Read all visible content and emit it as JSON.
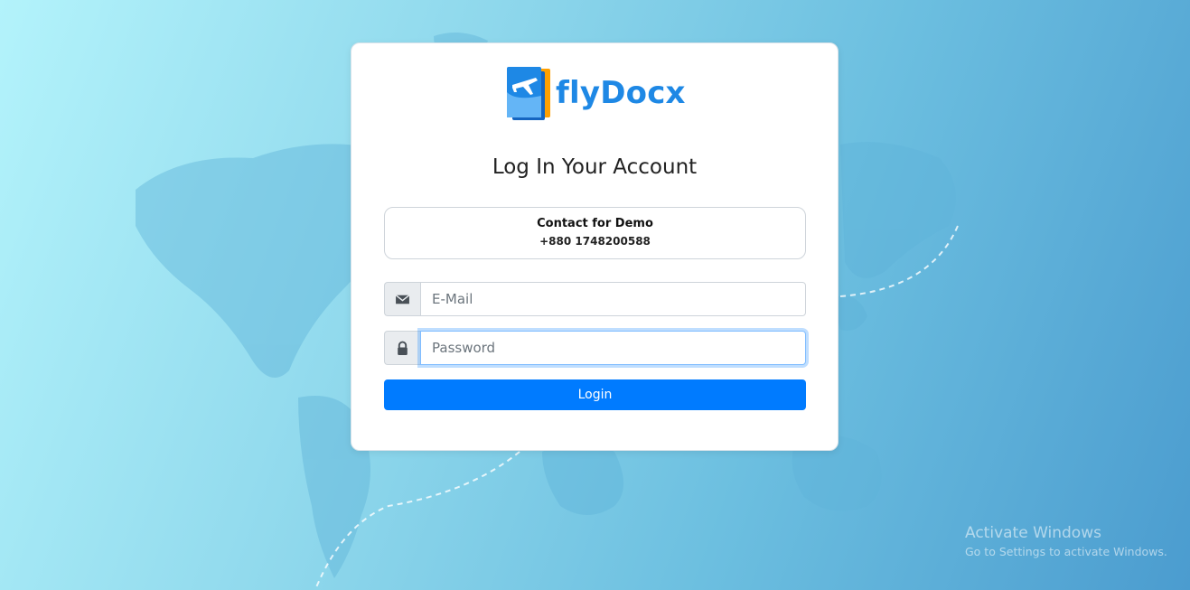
{
  "brand": {
    "name": "flyDocx"
  },
  "login": {
    "title": "Log In Your Account",
    "contact_title": "Contact for Demo",
    "contact_phone": "+880 1748200588",
    "email_placeholder": "E-Mail",
    "email_icon": "envelope-icon",
    "email_value": "",
    "password_placeholder": "Password",
    "password_icon": "lock-icon",
    "password_value": "",
    "login_label": "Login"
  },
  "watermark": {
    "title": "Activate Windows",
    "subtitle": "Go to Settings to activate Windows."
  },
  "colors": {
    "accent": "#007bff",
    "brand": "#1e88e5",
    "addon_bg": "#e9ecef"
  }
}
